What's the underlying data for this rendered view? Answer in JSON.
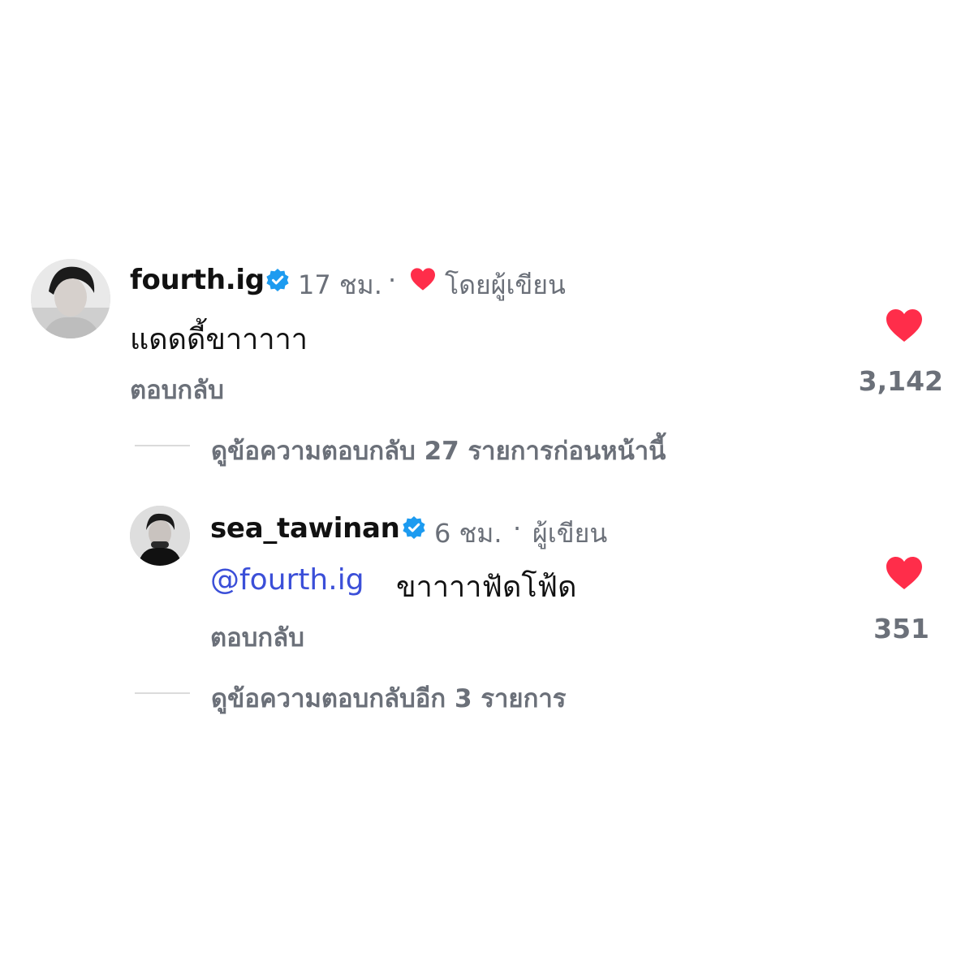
{
  "comment": {
    "username": "fourth.ig",
    "time": "17 ชม.",
    "separator": "·",
    "liked_by_author": "โดยผู้เขียน",
    "text": "แดดดี้ขาาาาา",
    "reply_label": "ตอบกลับ",
    "like_count": "3,142",
    "view_prev_replies": "ดูข้อความตอบกลับ 27 รายการก่อนหน้านี้"
  },
  "reply": {
    "username": "sea_tawinan",
    "time": "6 ชม.",
    "separator": "·",
    "author_tag": "ผู้เขียน",
    "mention": "@fourth.ig",
    "text": "ขาาาาฟัดโฟ้ด",
    "reply_label": "ตอบกลับ",
    "like_count": "351",
    "view_more_replies": "ดูข้อความตอบกลับอีก 3 รายการ"
  },
  "colors": {
    "heart": "#ff2d4a",
    "verified": "#1d9bf0",
    "mention": "#3b4fd8",
    "muted": "#6b7079"
  },
  "icons": [
    "verified-badge-icon",
    "heart-icon"
  ]
}
